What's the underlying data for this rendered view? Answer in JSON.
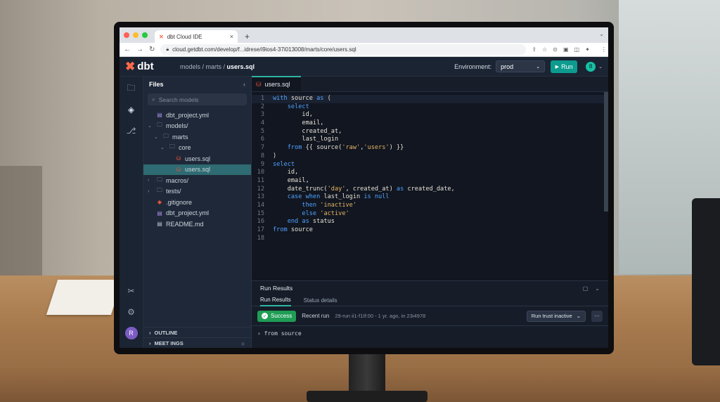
{
  "browser": {
    "tab_title": "dbt Cloud IDE",
    "tab_close": "×",
    "new_tab": "+",
    "url": "cloud.getdbt.com/develop/f...idrese/i9ios4-37i013008/marts/core/users.sql",
    "colors": {
      "red": "#ff5f57",
      "yellow": "#febc2e",
      "green": "#28c840"
    }
  },
  "topbar": {
    "logo_text": "dbt",
    "breadcrumb_prefix": "models / marts / ",
    "breadcrumb_current": "users.sql",
    "environment_label": "Environment:",
    "environment_value": "prod",
    "run_label": "Run",
    "user_initial": "8"
  },
  "sidebar": {
    "title": "Files",
    "search_placeholder": "Search models",
    "tree": [
      {
        "label": "dbt_project.yml",
        "type": "yml",
        "indent": 0,
        "caret": ""
      },
      {
        "label": "models/",
        "type": "folder",
        "indent": 0,
        "caret": "⌄"
      },
      {
        "label": "marts",
        "type": "folder",
        "indent": 1,
        "caret": "⌄"
      },
      {
        "label": "core",
        "type": "folder",
        "indent": 2,
        "caret": "⌄"
      },
      {
        "label": "users.sql",
        "type": "sql",
        "indent": 3,
        "caret": ""
      },
      {
        "label": "users.sql",
        "type": "sql",
        "indent": 3,
        "caret": "",
        "selected": true
      },
      {
        "label": "macros/",
        "type": "folder",
        "indent": 0,
        "caret": "›"
      },
      {
        "label": "tests/",
        "type": "folder",
        "indent": 0,
        "caret": "›"
      },
      {
        "label": ".gitignore",
        "type": "git",
        "indent": 0,
        "caret": ""
      },
      {
        "label": "dbt_project.yml",
        "type": "yml",
        "indent": 0,
        "caret": ""
      },
      {
        "label": "README.md",
        "type": "md",
        "indent": 0,
        "caret": ""
      }
    ],
    "outline_label": "OUTLINE",
    "meetings_label": "MEET INGS",
    "user_avatar": "R"
  },
  "editor": {
    "tab_label": "users.sql",
    "lines": [
      [
        {
          "t": "with",
          "c": "kw"
        },
        {
          "t": " source ",
          "c": "code"
        },
        {
          "t": "as",
          "c": "kw"
        },
        {
          "t": " (",
          "c": "code"
        }
      ],
      [
        {
          "t": "    select",
          "c": "kw"
        }
      ],
      [
        {
          "t": "        id,",
          "c": "code"
        }
      ],
      [
        {
          "t": "        email,",
          "c": "code"
        }
      ],
      [
        {
          "t": "        created_at,",
          "c": "code"
        }
      ],
      [
        {
          "t": "        last_login",
          "c": "code"
        }
      ],
      [
        {
          "t": "    from",
          "c": "kw"
        },
        {
          "t": " {{ source(",
          "c": "code"
        },
        {
          "t": "'raw'",
          "c": "str"
        },
        {
          "t": ",",
          "c": "code"
        },
        {
          "t": "'users'",
          "c": "str"
        },
        {
          "t": ") }}",
          "c": "code"
        }
      ],
      [
        {
          "t": ")",
          "c": "code"
        }
      ],
      [
        {
          "t": "select",
          "c": "kw"
        }
      ],
      [
        {
          "t": "    id,",
          "c": "code"
        }
      ],
      [
        {
          "t": "    email,",
          "c": "code"
        }
      ],
      [
        {
          "t": "    date_trunc(",
          "c": "code"
        },
        {
          "t": "'day'",
          "c": "str"
        },
        {
          "t": ", created_at) ",
          "c": "code"
        },
        {
          "t": "as",
          "c": "kw"
        },
        {
          "t": " created_date,",
          "c": "code"
        }
      ],
      [
        {
          "t": "    case when",
          "c": "kw"
        },
        {
          "t": " last_login ",
          "c": "code"
        },
        {
          "t": "is null",
          "c": "kw"
        }
      ],
      [
        {
          "t": "        then",
          "c": "kw"
        },
        {
          "t": " ",
          "c": "code"
        },
        {
          "t": "'inactive'",
          "c": "str"
        }
      ],
      [
        {
          "t": "        else",
          "c": "kw"
        },
        {
          "t": " ",
          "c": "code"
        },
        {
          "t": "'active'",
          "c": "str"
        }
      ],
      [
        {
          "t": "    end as",
          "c": "kw"
        },
        {
          "t": " status",
          "c": "code"
        }
      ],
      [
        {
          "t": "from",
          "c": "kw"
        },
        {
          "t": " source",
          "c": "code"
        }
      ],
      []
    ]
  },
  "results": {
    "title": "Run Results",
    "tabs": [
      "Run Results",
      "Status details"
    ],
    "status": "Success",
    "recent_label": "Recent run",
    "meta": "29-run i​i1-f1If:00 - 1 yr. ago, in 2​3i4978",
    "trust_label": "Run trust inactive",
    "more": "···",
    "preview": "from source"
  }
}
